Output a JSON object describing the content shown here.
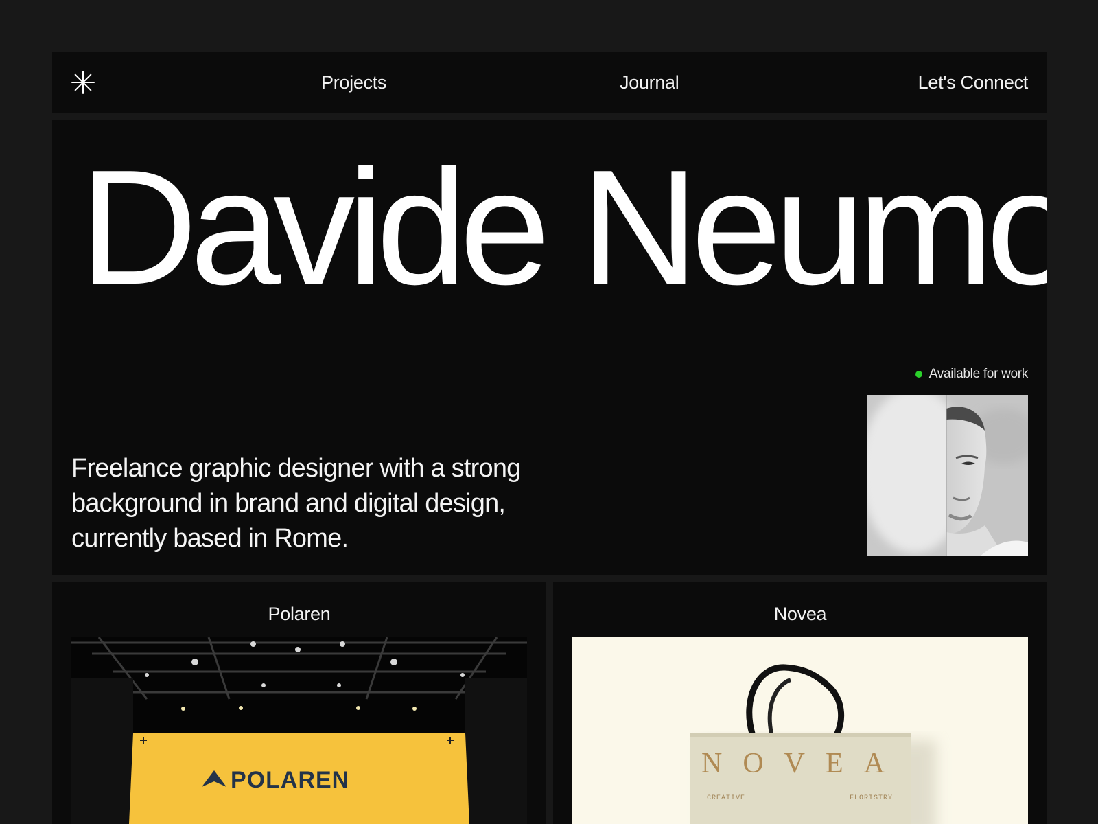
{
  "nav": {
    "logo_icon": "asterisk-icon",
    "projects": "Projects",
    "journal": "Journal",
    "connect": "Let's Connect"
  },
  "hero": {
    "name": "Davide Neumo",
    "status": "Available for work",
    "status_color": "#2bd12b",
    "bio": "Freelance graphic designer with a strong background in brand and digital design, currently based in Rome."
  },
  "projects": [
    {
      "title": "Polaren",
      "brand_text": "POLAREN",
      "accent": "#f6c23c"
    },
    {
      "title": "Novea",
      "brand_text": "NOVEA",
      "tagline_left": "CREATIVE",
      "tagline_right": "FLORISTRY"
    }
  ],
  "colors": {
    "page_bg": "#181818",
    "panel_bg": "#0b0b0b",
    "text": "#ffffff"
  }
}
